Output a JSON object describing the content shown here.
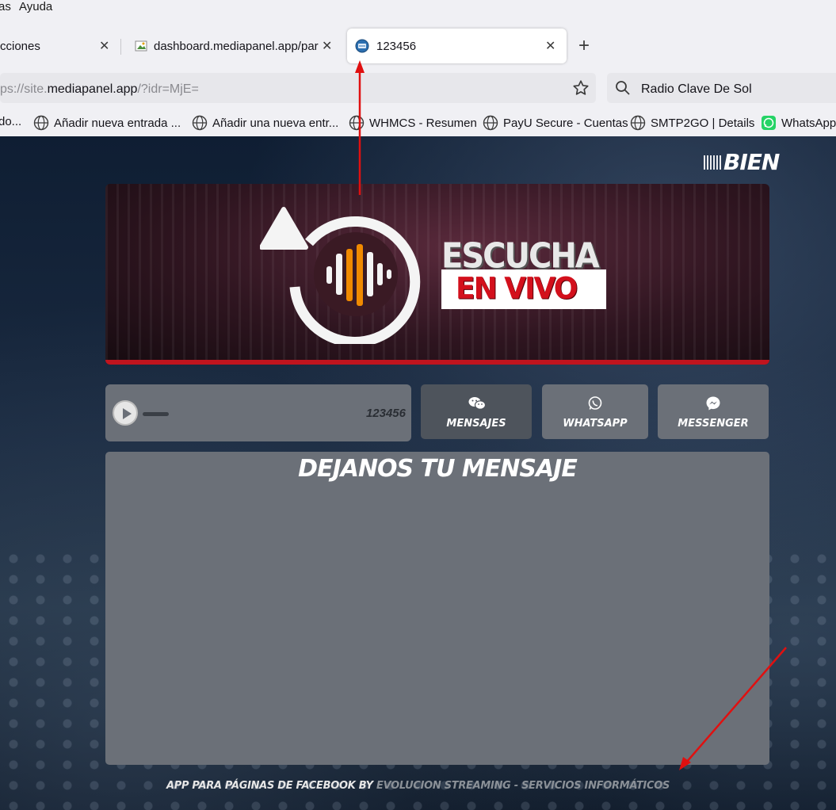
{
  "menubar": {
    "items": [
      "as",
      "Ayuda"
    ]
  },
  "tabs": [
    {
      "label": "cciones",
      "active": false
    },
    {
      "label": "dashboard.mediapanel.app/par",
      "active": false
    },
    {
      "label": "123456",
      "active": true
    }
  ],
  "address_bar": {
    "url_prefix": "ps://site.",
    "url_domain": "mediapanel.app",
    "url_path": "/?idr=MjE="
  },
  "search_bar": {
    "value": "Radio Clave De Sol"
  },
  "bookmarks": [
    {
      "label": "do...",
      "icon": "globe-icon"
    },
    {
      "label": "Añadir nueva entrada ...",
      "icon": "globe-icon"
    },
    {
      "label": "Añadir una nueva entr...",
      "icon": "globe-icon"
    },
    {
      "label": "WHMCS - Resumen",
      "icon": "globe-icon"
    },
    {
      "label": "PayU Secure - Cuentas",
      "icon": "globe-icon"
    },
    {
      "label": "SMTP2GO | Details",
      "icon": "globe-icon"
    },
    {
      "label": "WhatsApp",
      "icon": "whatsapp-icon"
    }
  ],
  "page": {
    "top_logo": "BIEN",
    "banner": {
      "line1": "ESCUCHA",
      "line2": "EN VIVO"
    },
    "player": {
      "title": "123456"
    },
    "buttons": {
      "mensajes": "MENSAJES",
      "whatsapp": "WHATSAPP",
      "messenger": "MESSENGER"
    },
    "message_title": "DEJANOS TU MENSAJE",
    "footer": {
      "prefix": "APP PARA PÁGINAS DE FACEBOOK BY",
      "credit": "EVOLUCION STREAMING - SERVICIOS INFORMÁTICOS"
    }
  },
  "colors": {
    "accent_red": "#c0141e",
    "panel_gray": "#6b7078",
    "annotation_arrow": "#e01010"
  }
}
